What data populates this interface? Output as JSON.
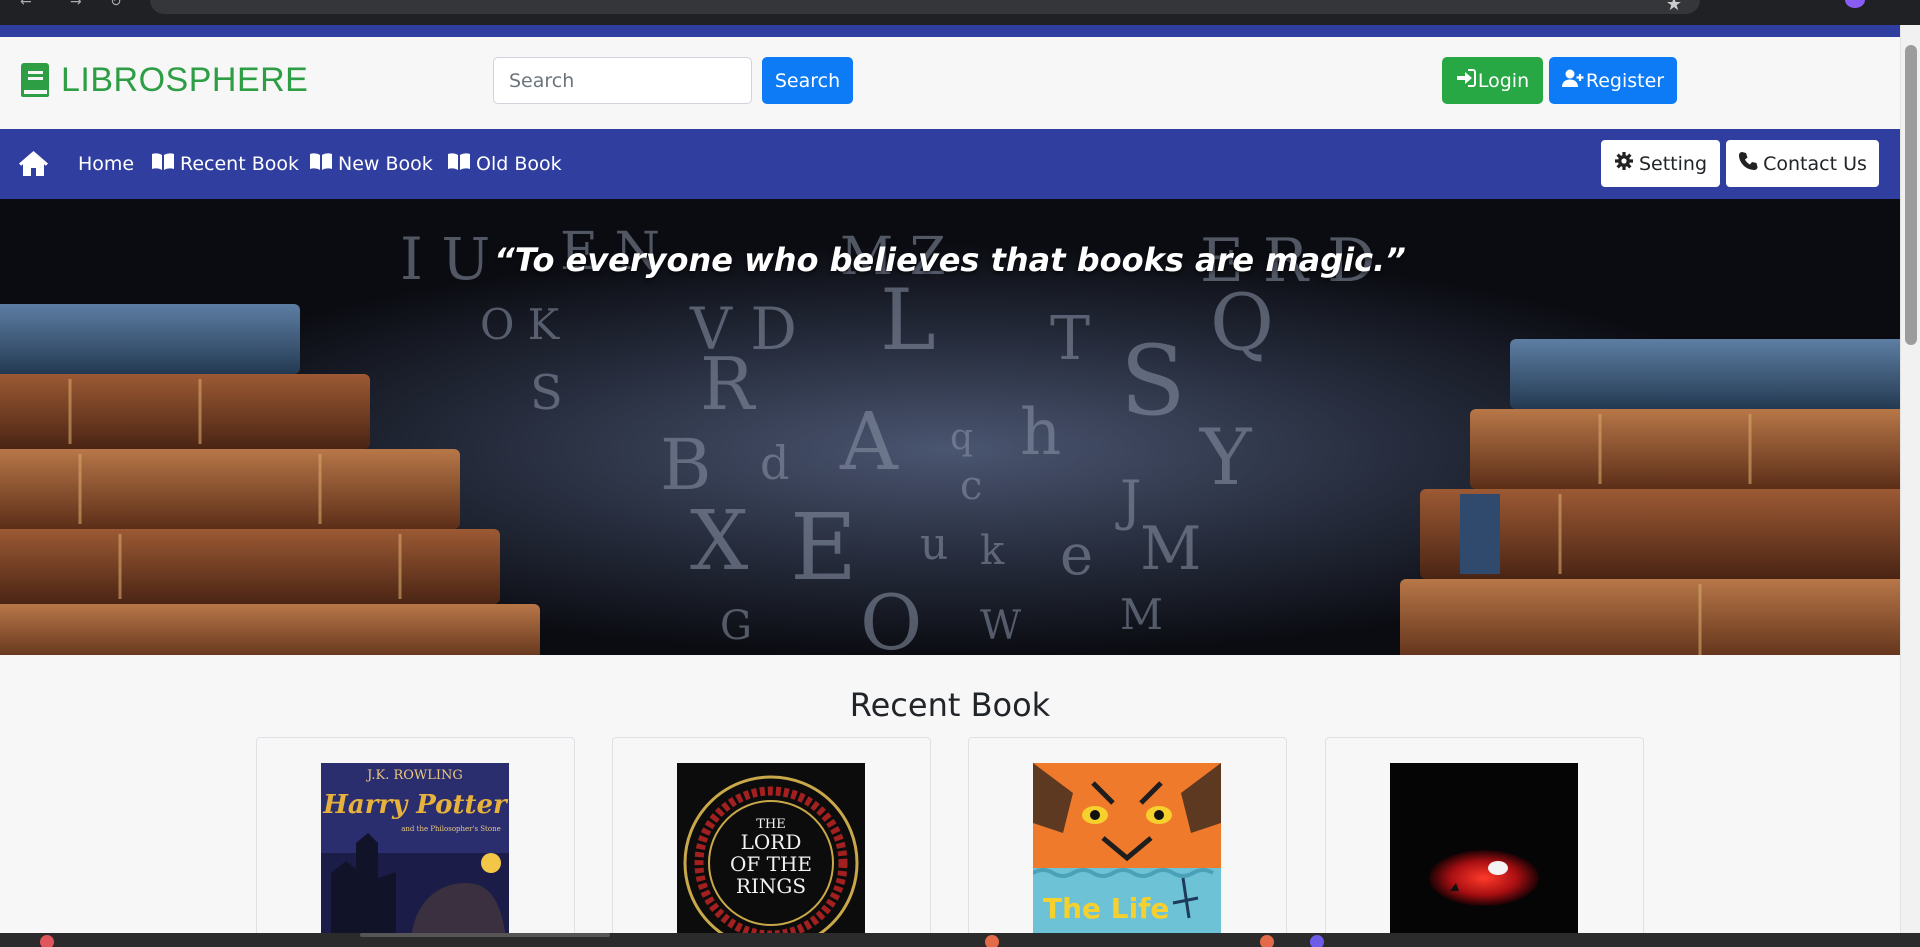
{
  "brand": {
    "name": "LIBROSPHERE",
    "color": "#2e9e44"
  },
  "search": {
    "placeholder": "Search",
    "value": "",
    "button_label": "Search"
  },
  "auth": {
    "login_label": "Login",
    "register_label": "Register"
  },
  "nav": {
    "links": [
      {
        "label": "Home"
      },
      {
        "label": "Recent Book"
      },
      {
        "label": "New Book"
      },
      {
        "label": "Old Book"
      }
    ],
    "setting_label": "Setting",
    "contact_label": "Contact Us"
  },
  "hero": {
    "quote": "“To everyone who believes that books are magic.”"
  },
  "recent": {
    "title": "Recent Book",
    "books": [
      {
        "cover_author": "J.K. ROWLING",
        "cover_title": "Harry Potter",
        "cover_subtitle": "and the Philosopher's Stone"
      },
      {
        "cover_title_line1": "THE",
        "cover_title_line2": "LORD",
        "cover_title_line3": "OF THE",
        "cover_title_line4": "RINGS"
      },
      {
        "cover_title": "The Life"
      },
      {
        "cover_title": ""
      }
    ]
  },
  "colors": {
    "accent": "#303f9f",
    "primary": "#0d7bf5",
    "success": "#28a745"
  },
  "icons": [
    "book-icon",
    "sign-in-icon",
    "user-plus-icon",
    "home-icon",
    "open-book-icon",
    "gear-icon",
    "phone-icon"
  ]
}
